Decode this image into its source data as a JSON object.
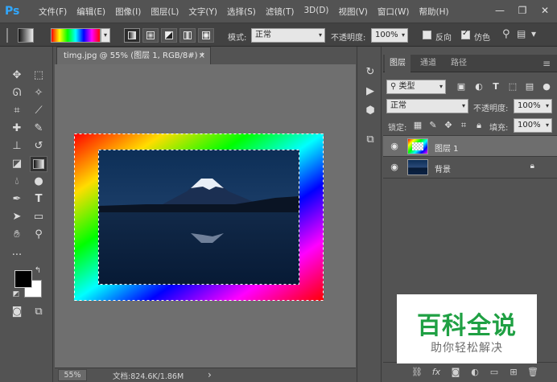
{
  "app": {
    "logo": "Ps"
  },
  "menu": [
    "文件(F)",
    "编辑(E)",
    "图像(I)",
    "图层(L)",
    "文字(Y)",
    "选择(S)",
    "滤镜(T)",
    "3D(D)",
    "视图(V)",
    "窗口(W)",
    "帮助(H)"
  ],
  "window_controls": {
    "minimize": "—",
    "restore": "❐",
    "close": "✕"
  },
  "options": {
    "mode_label": "模式:",
    "mode_value": "正常",
    "opacity_label": "不透明度:",
    "opacity_value": "100%",
    "reverse_label": "反向",
    "reverse_checked": false,
    "dither_label": "仿色",
    "dither_checked": true
  },
  "document": {
    "tab_title": "timg.jpg @ 55% (图层 1, RGB/8#) *",
    "tab_close": "×",
    "zoom": "55%",
    "doc_info": "文档:824.6K/1.86M",
    "status_arrow": "›"
  },
  "layers_panel": {
    "tabs": [
      "图层",
      "通道",
      "路径"
    ],
    "active_tab": 0,
    "menu_icon": "≡",
    "filter_type": "类型",
    "blend_mode": "正常",
    "opacity_label": "不透明度:",
    "opacity_value": "100%",
    "lock_label": "锁定:",
    "fill_label": "填充:",
    "fill_value": "100%",
    "layers": [
      {
        "name": "图层 1",
        "selected": true,
        "locked": false
      },
      {
        "name": "背景",
        "selected": false,
        "locked": true
      }
    ]
  },
  "watermark": {
    "title": "百科全说",
    "subtitle": "助你轻松解决"
  },
  "colors": {
    "accent": "#31a8ff",
    "watermark_green": "#1fa043",
    "panel_bg": "#535353",
    "canvas_bg": "#6f6f6f"
  }
}
